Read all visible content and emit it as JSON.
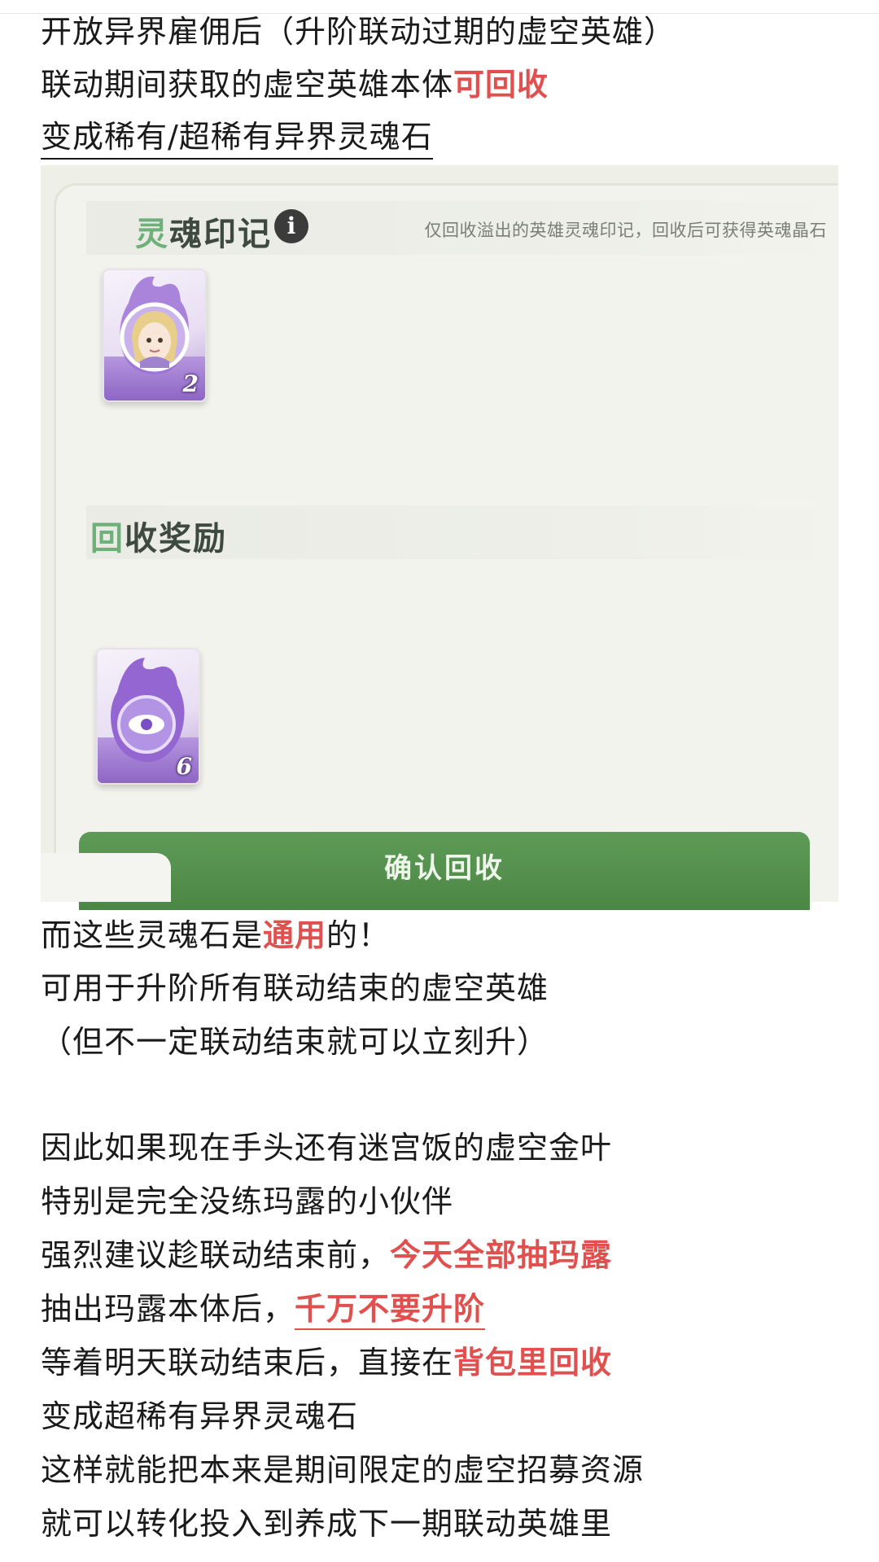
{
  "intro": {
    "line1": "开放异界雇佣后（升阶联动过期的虚空英雄）",
    "line2_a": "联动期间获取的虚空英雄本体",
    "line2_b": "可回收",
    "line3": "变成稀有/超稀有异界灵魂石"
  },
  "game": {
    "soul_mark_title_a": "灵",
    "soul_mark_title_b": "魂印记",
    "info_icon": "info-icon",
    "hint": "仅回收溢出的英雄灵魂印记，回收后可获得英魂晶石",
    "soul_card_count": "2",
    "reward_title_a": "回",
    "reward_title_b": "收奖励",
    "reward_card_count": "6",
    "confirm_label": "确认回收"
  },
  "body": {
    "l1_a": "而这些灵魂石是",
    "l1_b": "通用",
    "l1_c": "的！",
    "l2": "可用于升阶所有联动结束的虚空英雄",
    "l3": "（但不一定联动结束就可以立刻升）",
    "l4": "因此如果现在手头还有迷宫饭的虚空金叶",
    "l5": "特别是完全没练玛露的小伙伴",
    "l6_a": "强烈建议趁联动结束前，",
    "l6_b": "今天全部抽玛露",
    "l7_a": "抽出玛露本体后，",
    "l7_b": "千万不要升阶",
    "l8_a": "等着明天联动结束后，直接在",
    "l8_b": "背包里回收",
    "l9": "变成超稀有异界灵魂石",
    "l10": "这样就能把本来是期间限定的虚空招募资源",
    "l11": "就可以转化投入到养成下一期联动英雄里"
  },
  "colors": {
    "accent_red": "#e0504e",
    "button_green": "#558f4f",
    "soul_purple": "#9b74d0"
  }
}
